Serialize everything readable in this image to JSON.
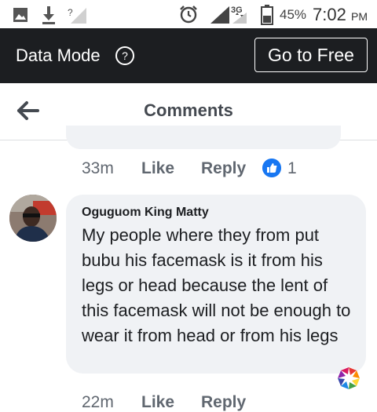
{
  "status_bar": {
    "battery_percent": "45%",
    "time": "7:02",
    "ampm": "PM",
    "network": "3G",
    "icons": [
      "image-icon",
      "download-icon",
      "no-signal-icon",
      "alarm-icon",
      "signal-icon",
      "battery-icon"
    ]
  },
  "data_mode": {
    "label": "Data Mode",
    "info_icon": "?",
    "go_free_label": "Go to Free"
  },
  "header": {
    "title": "Comments",
    "back_icon": "arrow-left-icon"
  },
  "previous_comment_actions": {
    "time": "33m",
    "like_label": "Like",
    "reply_label": "Reply",
    "reaction_count": "1"
  },
  "comment": {
    "author": "Oguguom King Matty",
    "text": "My people where they from put bubu his facemask is it from his legs or head because the lent of this facemask will not be enough to wear it from head or from his legs",
    "time": "22m",
    "like_label": "Like",
    "reply_label": "Reply"
  },
  "colors": {
    "data_mode_bg": "#1c1e21",
    "like_blue": "#1877f2",
    "bubble_bg": "#f0f2f5"
  }
}
